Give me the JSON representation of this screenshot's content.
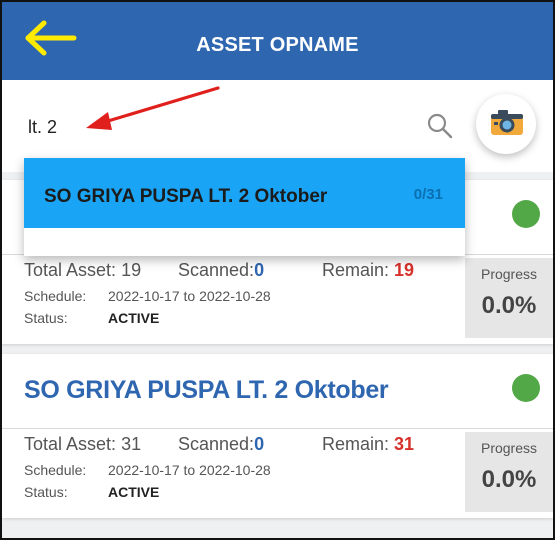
{
  "header": {
    "title": "ASSET OPNAME",
    "back_icon": "arrow-left-icon",
    "back_color": "#ffeb00",
    "bg_color": "#2f66b0"
  },
  "search": {
    "value": "lt. 2",
    "search_icon": "search-icon",
    "camera_icon": "camera-icon"
  },
  "suggestions": [
    {
      "title": "SO GRIYA PUSPA LT. 2 Oktober",
      "count": "0/31"
    }
  ],
  "cards": [
    {
      "title": "",
      "status_color": "#52a847",
      "total_label": "Total Asset:",
      "total_value": "19",
      "scanned_label": "Scanned:",
      "scanned_value": "0",
      "remain_label": "Remain:",
      "remain_value": "19",
      "schedule_label": "Schedule:",
      "schedule_value": "2022-10-17 to 2022-10-28",
      "status_label": "Status:",
      "status_value": "ACTIVE",
      "progress_label": "Progress",
      "progress_value": "0.0%"
    },
    {
      "title": "SO GRIYA PUSPA LT. 2 Oktober",
      "status_color": "#52a847",
      "total_label": "Total Asset:",
      "total_value": "31",
      "scanned_label": "Scanned:",
      "scanned_value": "0",
      "remain_label": "Remain:",
      "remain_value": "31",
      "schedule_label": "Schedule:",
      "schedule_value": "2022-10-17 to 2022-10-28",
      "status_label": "Status:",
      "status_value": "ACTIVE",
      "progress_label": "Progress",
      "progress_value": "0.0%"
    }
  ]
}
